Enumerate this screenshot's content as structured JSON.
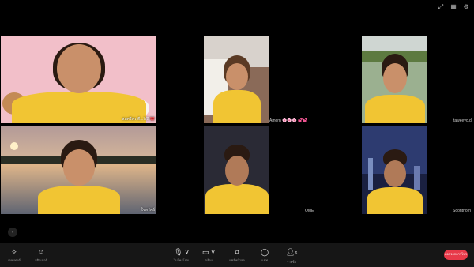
{
  "participants": [
    {
      "name": "สมศรีพร ดี...7/2",
      "emoji": "🎀"
    },
    {
      "name": "Amorn",
      "decor": "🌸🌸🌸 💕💕"
    },
    {
      "name": "taweeyo.d"
    },
    {
      "name": "ใจทรัพย์"
    },
    {
      "name": "OME"
    },
    {
      "name": "Soonthorn"
    }
  ],
  "toolbar": {
    "effects_label": "เอฟเฟกต์",
    "stickers_label": "สติกเกอร์",
    "mic_label": "ไมโครโฟน",
    "camera_label": "กล้อง",
    "share_label": "แชร์หน้าจอ",
    "chat_label": "แชท",
    "members_label": "รายชื่อ",
    "members_count": "6",
    "leave_label": "ออกจากการโทร"
  },
  "icons": [
    "expand-icon",
    "grid-icon",
    "settings-icon",
    "effects-icon",
    "sticker-icon",
    "mic-icon",
    "camera-icon",
    "share-screen-icon",
    "chat-icon",
    "members-icon",
    "line-logo"
  ]
}
